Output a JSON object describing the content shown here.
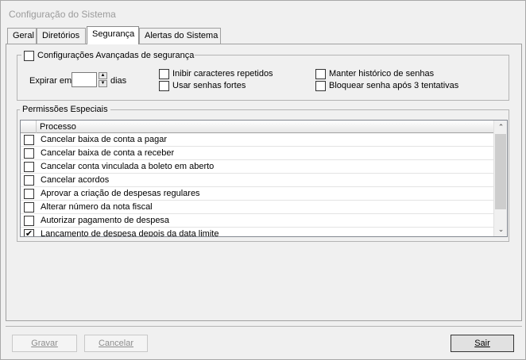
{
  "window": {
    "title": "Configuração do Sistema"
  },
  "tabs": [
    {
      "label": "Geral"
    },
    {
      "label": "Diretórios"
    },
    {
      "label": "Segurança",
      "active": true
    },
    {
      "label": "Alertas do Sistema"
    }
  ],
  "advanced": {
    "legend": "Configurações Avançadas de segurança",
    "checked": false,
    "expire_label": "Expirar em",
    "expire_value": "",
    "expire_unit": "dias",
    "options": [
      {
        "label": "Inibir caracteres repetidos",
        "checked": false
      },
      {
        "label": "Usar senhas fortes",
        "checked": false
      },
      {
        "label": "Manter histórico de senhas",
        "checked": false
      },
      {
        "label": "Bloquear senha após 3 tentativas",
        "checked": false
      }
    ]
  },
  "permissions": {
    "legend": "Permissões Especiais",
    "column_header": "Processo",
    "rows": [
      {
        "label": "Cancelar baixa de conta a pagar",
        "checked": false
      },
      {
        "label": "Cancelar baixa de conta a receber",
        "checked": false
      },
      {
        "label": "Cancelar conta vinculada a boleto em aberto",
        "checked": false
      },
      {
        "label": "Cancelar acordos",
        "checked": false
      },
      {
        "label": "Aprovar a criação de despesas regulares",
        "checked": false
      },
      {
        "label": "Alterar número da nota fiscal",
        "checked": false
      },
      {
        "label": "Autorizar pagamento de despesa",
        "checked": false
      },
      {
        "label": "Lançamento de despesa depois da data limite",
        "checked": true
      }
    ]
  },
  "buttons": {
    "save": "Gravar",
    "cancel": "Cancelar",
    "exit": "Sair"
  },
  "glyphs": {
    "check": "✔",
    "up": "▲",
    "down": "▼",
    "scroll_up": "⌃",
    "scroll_down": "⌄"
  }
}
